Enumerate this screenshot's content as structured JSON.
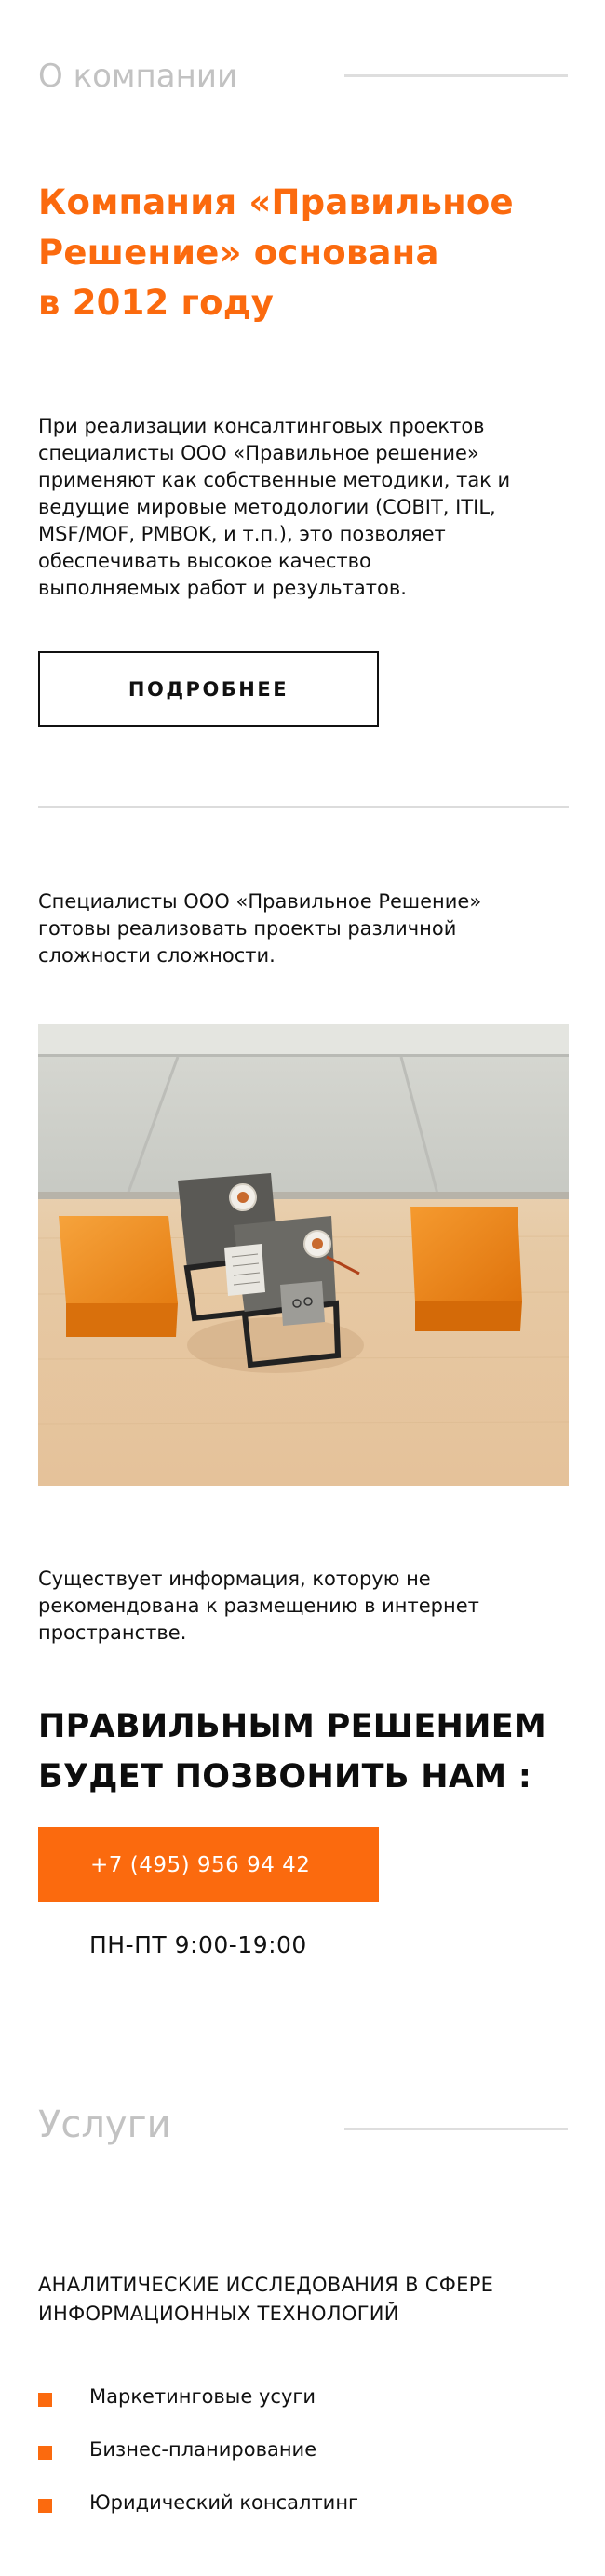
{
  "colors": {
    "accent": "#fb6a0e",
    "muted_title": "#c2c2c2",
    "divider": "#dedede",
    "text": "#111111"
  },
  "about": {
    "section_title": "О компании",
    "headline_lines": [
      "Компания «Правильное",
      "Решение» основана",
      "в 2012 году"
    ],
    "paragraph_lines": [
      "При реализации консалтинговых проектов",
      "специалисты ООО «Правильное решение»",
      "применяют как собственные методики, так и",
      "ведущие мировые методологии (COBIT, ITIL,",
      "MSF/MOF, PMBOK, и т.п.), это позволяет",
      "обеспечивать высокое качество",
      "выполняемых работ и результатов."
    ],
    "more_button": "ПОДРОБНЕЕ"
  },
  "specialists": {
    "text_lines": [
      "Специалисты ООО «Правильное Решение»",
      "готовы реализовать проекты различной",
      "сложности сложности."
    ],
    "photo_subject": "office-table-orange-poufs"
  },
  "contact": {
    "info_lines": [
      "Существует информация, которую не",
      "рекомендована к размещению в интернет",
      "пространстве."
    ],
    "callout_lines": [
      "ПРАВИЛЬНЫМ РЕШЕНИЕМ",
      "БУДЕТ ПОЗВОНИТЬ НАМ :"
    ],
    "phone": "+7 (495) 956 94 42",
    "hours": "ПН-ПТ 9:00-19:00"
  },
  "services": {
    "section_title": "Услуги",
    "subheading_lines": [
      "АНАЛИТИЧЕСКИЕ ИССЛЕДОВАНИЯ В СФЕРЕ",
      "ИНФОРМАЦИОННЫХ ТЕХНОЛОГИЙ"
    ],
    "items": [
      "Маркетинговые усуги",
      "Бизнес-планирование",
      "Юридический консалтинг"
    ]
  }
}
